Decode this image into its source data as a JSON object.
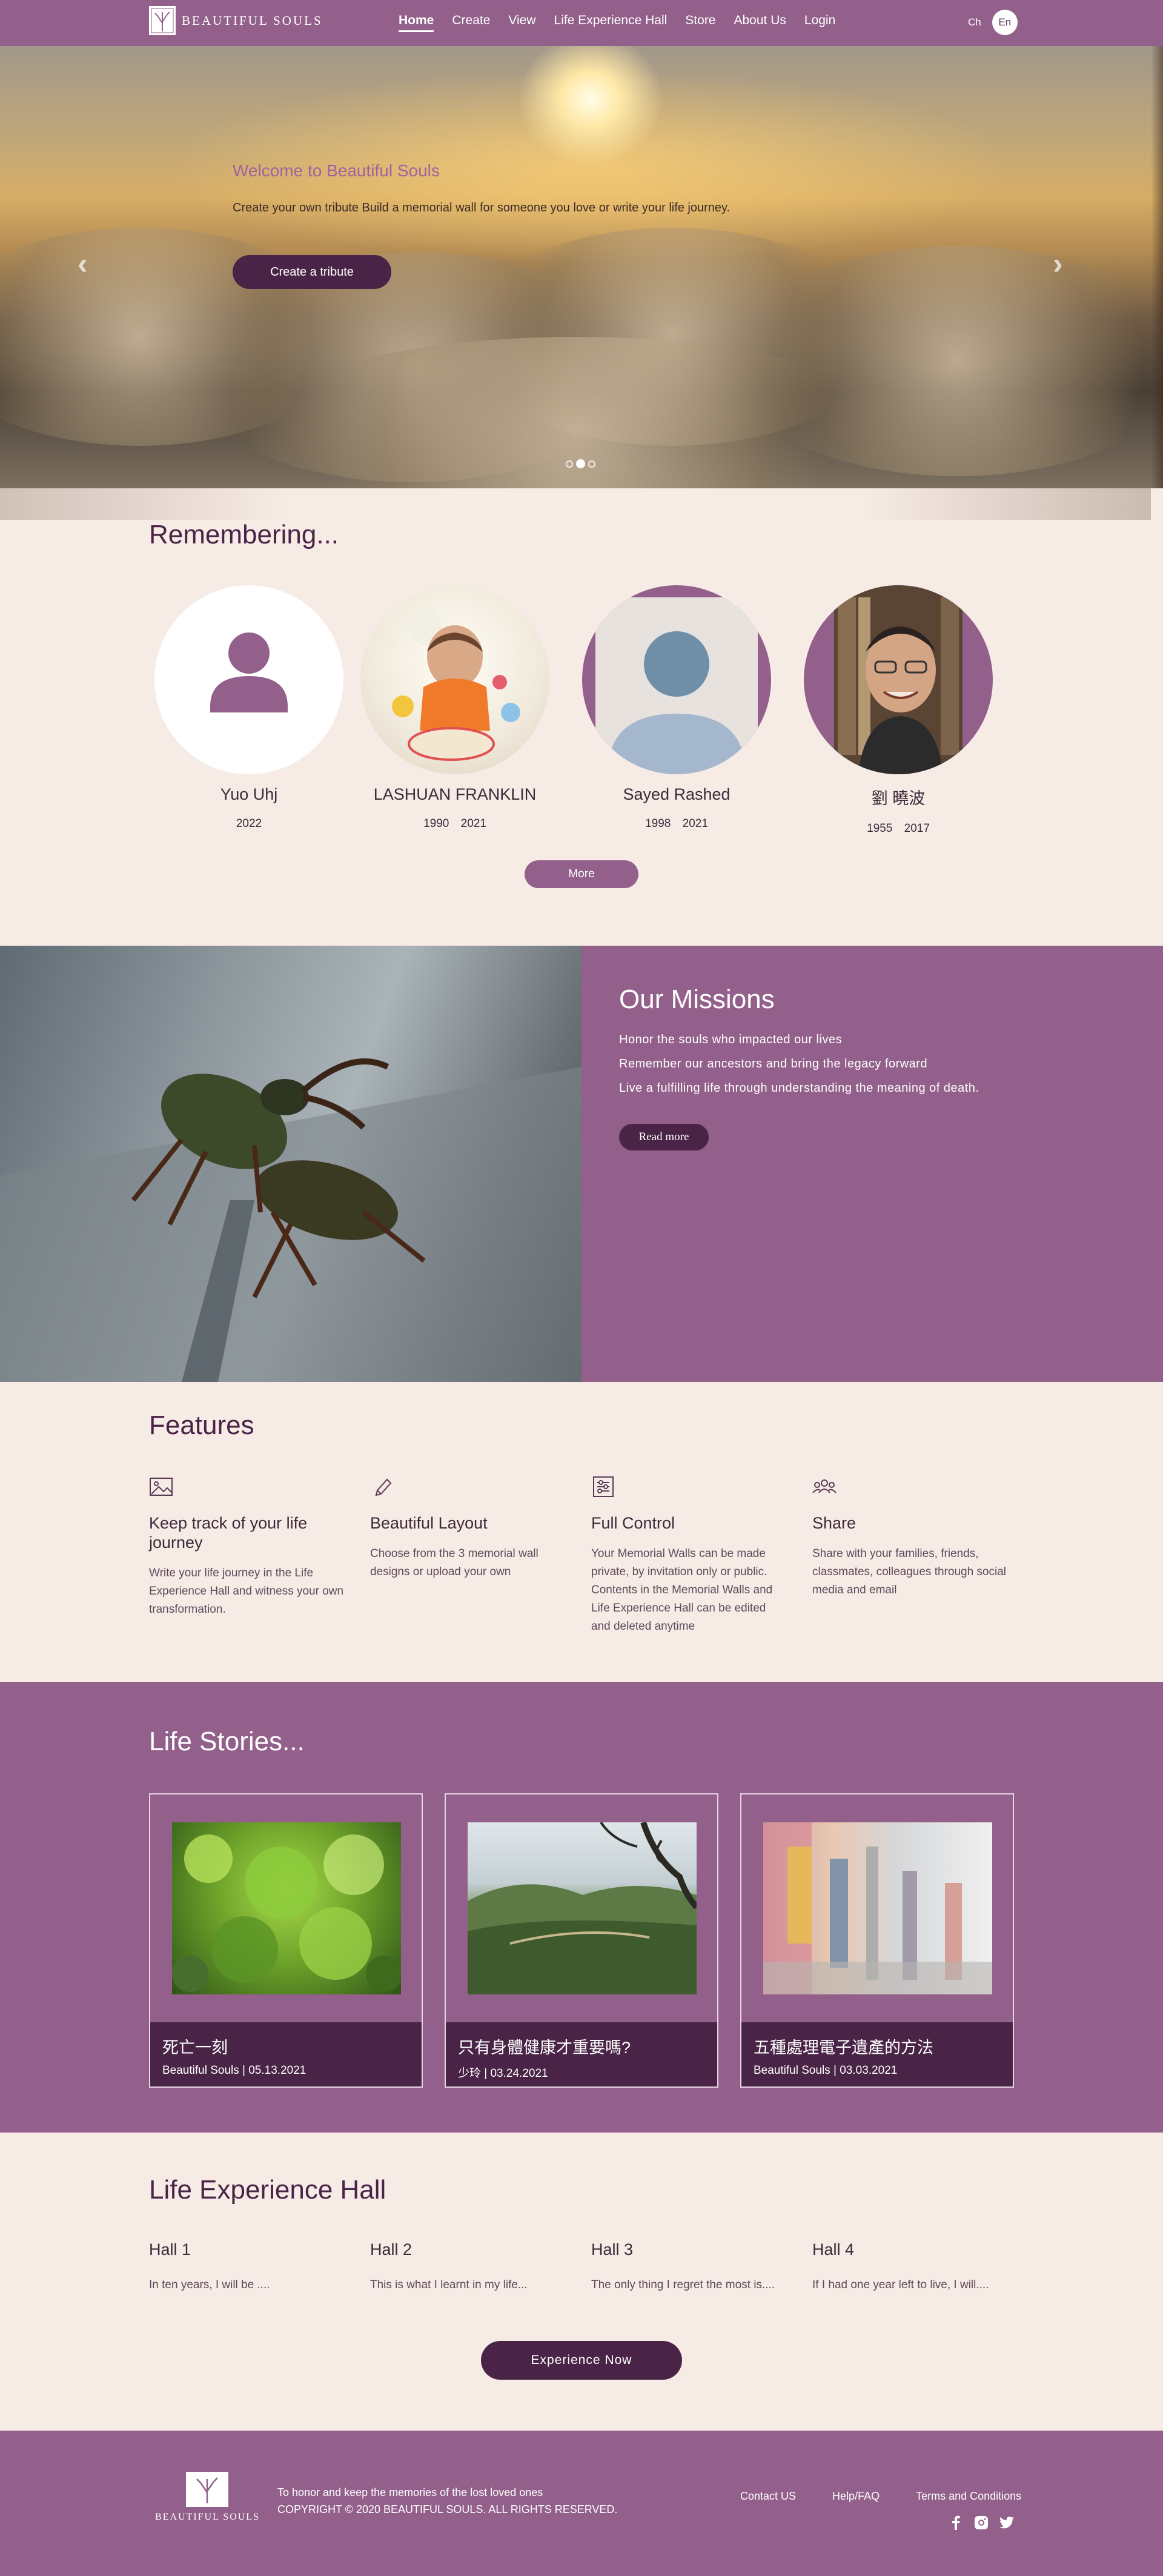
{
  "brand": {
    "name": "BEAUTIFUL SOULS"
  },
  "nav": {
    "links": [
      "Home",
      "Create",
      "View",
      "Life Experience Hall",
      "Store",
      "About Us",
      "Login"
    ],
    "lang": [
      "Ch",
      "En"
    ]
  },
  "hero": {
    "title": "Welcome to Beautiful Souls",
    "subtitle": "Create your own tribute Build a memorial wall for someone you love or write your life journey.",
    "cta": "Create a tribute",
    "slides": 3,
    "active_slide": 2
  },
  "remembering": {
    "title": "Remembering...",
    "people": [
      {
        "name": "Yuo Uhj",
        "years": "2022"
      },
      {
        "name": "LASHUAN FRANKLIN",
        "years": "1990 2021"
      },
      {
        "name": "Sayed Rashed",
        "years": "1998 2021"
      },
      {
        "name": "劉 曉波",
        "years": "1955 2017"
      }
    ],
    "more": "More"
  },
  "missions": {
    "title": "Our Missions",
    "lines": [
      "Honor the souls who impacted our lives",
      "Remember our ancestors and bring the legacy forward",
      "Live a fulfilling life through understanding the meaning of death."
    ],
    "read_more": "Read more"
  },
  "features": {
    "title": "Features",
    "items": [
      {
        "icon": "image-icon",
        "title": "Keep track of your life journey",
        "desc": "Write your life journey in the Life Experience Hall and witness your own transformation."
      },
      {
        "icon": "pen-icon",
        "title": "Beautiful Layout",
        "desc": "Choose from the 3 memorial wall designs or upload your own"
      },
      {
        "icon": "sliders-icon",
        "title": "Full Control",
        "desc": "Your Memorial Walls can be made private, by invitation only or public. Contents in the Memorial Walls and Life Experience Hall can be edited and deleted anytime"
      },
      {
        "icon": "people-icon",
        "title": "Share",
        "desc": "Share with your families, friends, classmates, colleagues through social media and email"
      }
    ]
  },
  "stories": {
    "title": "Life Stories...",
    "items": [
      {
        "title": "死亡一刻",
        "meta": "Beautiful Souls | 05.13.2021"
      },
      {
        "title": "只有身體健康才重要嗎?",
        "meta": "少玲 | 03.24.2021"
      },
      {
        "title": "五種處理電子遺產的方法",
        "meta": "Beautiful Souls | 03.03.2021"
      }
    ]
  },
  "hall": {
    "title": "Life Experience Hall",
    "items": [
      {
        "name": "Hall 1",
        "text": "In ten years, I will be ...."
      },
      {
        "name": "Hall 2",
        "text": "This is what I learnt in my life..."
      },
      {
        "name": "Hall 3",
        "text": "The only thing I regret the most is...."
      },
      {
        "name": "Hall 4",
        "text": "If I had one year left to live, I will...."
      }
    ],
    "cta": "Experience Now"
  },
  "footer": {
    "tagline": "To honor and keep the memories of the lost loved ones",
    "copyright": "COPYRIGHT © 2020 BEAUTIFUL SOULS. ALL RIGHTS RESERVED.",
    "links": [
      "Contact US",
      "Help/FAQ",
      "Terms and Conditions"
    ],
    "socials": [
      "facebook-icon",
      "instagram-icon",
      "twitter-icon"
    ]
  },
  "colors": {
    "primary": "#93608b",
    "dark": "#4a2447",
    "bg": "#f7ebe5"
  }
}
